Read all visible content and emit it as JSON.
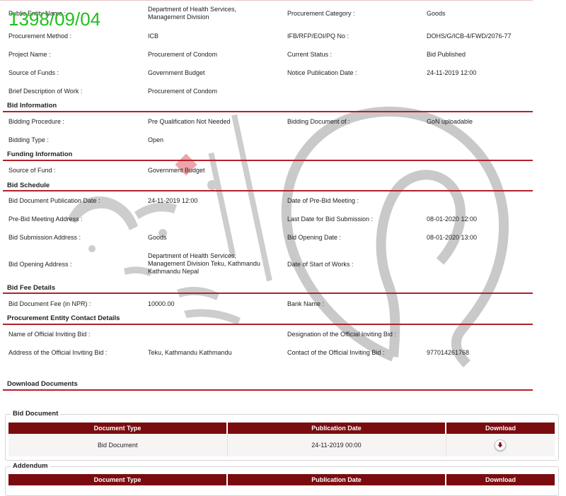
{
  "datestamp": "1398/09/04",
  "general": [
    {
      "l1": "Public Entity Name :",
      "v1": "Department of Health Services, Management Division",
      "l2": "Procurement Category :",
      "v2": "Goods"
    },
    {
      "l1": "Procurement Method :",
      "v1": "ICB",
      "l2": "IFB/RFP/EOI/PQ No :",
      "v2": "DOHS/G/ICB-4/FWD/2076-77"
    },
    {
      "l1": "Project Name :",
      "v1": "Procurement of Condom",
      "l2": "Current Status :",
      "v2": "Bid Published"
    },
    {
      "l1": "Source of Funds :",
      "v1": "Government Budget",
      "l2": "Notice Publication Date :",
      "v2": "24-11-2019 12:00"
    },
    {
      "l1": "Brief Description of Work :",
      "v1": "Procurement of Condom",
      "l2": "",
      "v2": ""
    }
  ],
  "bid_information": {
    "title": "Bid Information",
    "rows": [
      {
        "l1": "Bidding Procedure :",
        "v1": "Pre Qualification Not Needed",
        "l2": "Bidding Document of :",
        "v2": "GoN uploadable"
      },
      {
        "l1": "Bidding Type :",
        "v1": "Open",
        "l2": "",
        "v2": ""
      }
    ]
  },
  "funding_information": {
    "title": "Funding Information",
    "rows": [
      {
        "l1": "Source of Fund :",
        "v1": "Government Budget",
        "l2": "",
        "v2": ""
      }
    ]
  },
  "bid_schedule": {
    "title": "Bid Schedule",
    "rows": [
      {
        "l1": "Bid Document Publication Date :",
        "v1": "24-11-2019 12:00",
        "l2": "Date of Pre-Bid Meeting :",
        "v2": ""
      },
      {
        "l1": "Pre-Bid Meeting Address :",
        "v1": "",
        "l2": "Last Date for Bid Submission :",
        "v2": "08-01-2020 12:00"
      },
      {
        "l1": "Bid Submission Address :",
        "v1": "Goods",
        "l2": "Bid Opening Date :",
        "v2": "08-01-2020 13:00"
      },
      {
        "l1": "Bid Opening Address :",
        "v1": "Department of Health Services, Management Division Teku, Kathmandu Kathmandu Nepal",
        "l2": "Date of Start of Works :",
        "v2": ""
      }
    ]
  },
  "bid_fee_details": {
    "title": "Bid Fee Details",
    "rows": [
      {
        "l1": "Bid Document Fee (in NPR) :",
        "v1": "10000.00",
        "l2": "Bank Name :",
        "v2": ""
      }
    ]
  },
  "contact_details": {
    "title": "Procurement Entity Contact Details",
    "rows": [
      {
        "l1": "Name of Official Inviting Bid :",
        "v1": "",
        "l2": "Designation of the Official Inviting Bid :",
        "v2": ""
      },
      {
        "l1": "Address of the Official Inviting Bid :",
        "v1": "Teku, Kathmandu Kathmandu",
        "l2": "Contact of the Official Inviting Bid :",
        "v2": "977014261768"
      }
    ]
  },
  "download_documents": {
    "title": "Download Documents"
  },
  "bid_document": {
    "legend": "Bid Document",
    "headers": [
      "Document Type",
      "Publication Date",
      "Download"
    ],
    "rows": [
      {
        "type": "Bid Document",
        "date": "24-11-2019 00:00",
        "icon": "download-icon"
      }
    ]
  },
  "addendum": {
    "legend": "Addendum",
    "headers": [
      "Document Type",
      "Publication Date",
      "Download"
    ]
  },
  "colors": {
    "section_line": "#b3202a",
    "table_header": "#7a0c10",
    "datestamp": "#1fbf1f",
    "watermark": "#b8b8b8"
  }
}
